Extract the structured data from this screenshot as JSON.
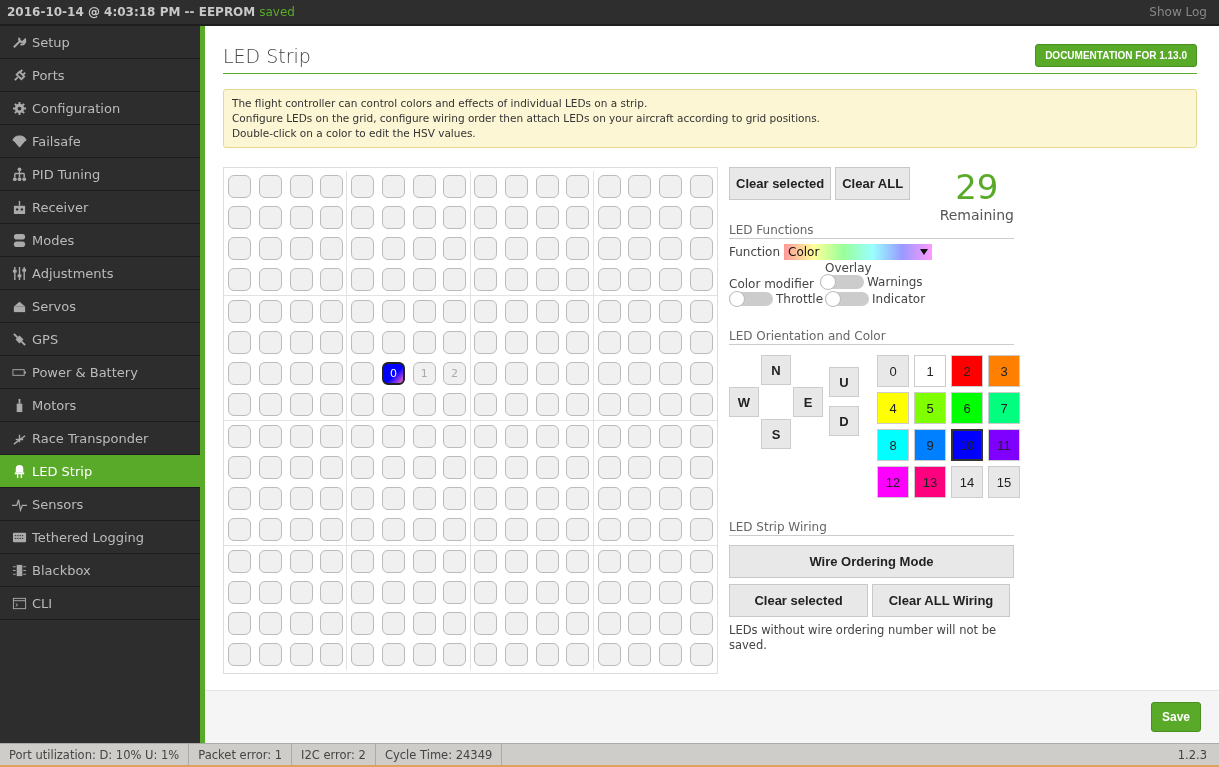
{
  "top_bar": {
    "timestamp": "2016-10-14 @ 4:03:18 PM -- EEPROM",
    "eeprom_state": "saved",
    "show_log": "Show Log"
  },
  "sidebar": {
    "items": [
      {
        "label": "Setup",
        "selected": false
      },
      {
        "label": "Ports",
        "selected": false
      },
      {
        "label": "Configuration",
        "selected": false
      },
      {
        "label": "Failsafe",
        "selected": false
      },
      {
        "label": "PID Tuning",
        "selected": false
      },
      {
        "label": "Receiver",
        "selected": false
      },
      {
        "label": "Modes",
        "selected": false
      },
      {
        "label": "Adjustments",
        "selected": false
      },
      {
        "label": "Servos",
        "selected": false
      },
      {
        "label": "GPS",
        "selected": false
      },
      {
        "label": "Power & Battery",
        "selected": false
      },
      {
        "label": "Motors",
        "selected": false
      },
      {
        "label": "Race Transponder",
        "selected": false
      },
      {
        "label": "LED Strip",
        "selected": true
      },
      {
        "label": "Sensors",
        "selected": false
      },
      {
        "label": "Tethered Logging",
        "selected": false
      },
      {
        "label": "Blackbox",
        "selected": false
      },
      {
        "label": "CLI",
        "selected": false
      }
    ]
  },
  "page": {
    "title": "LED Strip",
    "documentation_button": "DOCUMENTATION FOR 1.13.0",
    "info": [
      "The flight controller can control colors and effects of individual LEDs on a strip.",
      "Configure LEDs on the grid, configure wiring order then attach LEDs on your aircraft according to grid positions.",
      "Double-click on a color to edit the HSV values."
    ]
  },
  "led_grid": {
    "rows": [
      [
        {},
        {},
        {},
        {},
        {},
        {},
        {},
        {},
        {},
        {},
        {},
        {},
        {},
        {},
        {},
        {}
      ],
      [
        {},
        {},
        {},
        {},
        {},
        {},
        {},
        {},
        {},
        {},
        {},
        {},
        {},
        {},
        {},
        {}
      ],
      [
        {},
        {},
        {},
        {},
        {},
        {},
        {},
        {},
        {},
        {},
        {},
        {},
        {},
        {},
        {},
        {}
      ],
      [
        {},
        {},
        {},
        {},
        {},
        {},
        {},
        {},
        {},
        {},
        {},
        {},
        {},
        {},
        {},
        {}
      ],
      [
        {},
        {},
        {},
        {},
        {},
        {},
        {},
        {},
        {},
        {},
        {},
        {},
        {},
        {},
        {},
        {}
      ],
      [
        {},
        {},
        {},
        {},
        {},
        {},
        {},
        {},
        {},
        {},
        {},
        {},
        {},
        {},
        {},
        {}
      ],
      [
        {},
        {},
        {},
        {},
        {},
        {
          "wire": "0",
          "color": "#0000ff",
          "selected": true
        },
        {
          "wire": "1",
          "selected": false
        },
        {
          "wire": "2",
          "selected": false
        },
        {},
        {},
        {},
        {},
        {},
        {},
        {},
        {}
      ],
      [
        {},
        {},
        {},
        {},
        {},
        {},
        {},
        {},
        {},
        {},
        {},
        {},
        {},
        {},
        {},
        {}
      ],
      [
        {},
        {},
        {},
        {},
        {},
        {},
        {},
        {},
        {},
        {},
        {},
        {},
        {},
        {},
        {},
        {}
      ],
      [
        {},
        {},
        {},
        {},
        {},
        {},
        {},
        {},
        {},
        {},
        {},
        {},
        {},
        {},
        {},
        {}
      ],
      [
        {},
        {},
        {},
        {},
        {},
        {},
        {},
        {},
        {},
        {},
        {},
        {},
        {},
        {},
        {},
        {}
      ],
      [
        {},
        {},
        {},
        {},
        {},
        {},
        {},
        {},
        {},
        {},
        {},
        {},
        {},
        {},
        {},
        {}
      ],
      [
        {},
        {},
        {},
        {},
        {},
        {},
        {},
        {},
        {},
        {},
        {},
        {},
        {},
        {},
        {},
        {}
      ],
      [
        {},
        {},
        {},
        {},
        {},
        {},
        {},
        {},
        {},
        {},
        {},
        {},
        {},
        {},
        {},
        {}
      ],
      [
        {},
        {},
        {},
        {},
        {},
        {},
        {},
        {},
        {},
        {},
        {},
        {},
        {},
        {},
        {},
        {}
      ],
      [
        {},
        {},
        {},
        {},
        {},
        {},
        {},
        {},
        {},
        {},
        {},
        {},
        {},
        {},
        {},
        {}
      ]
    ]
  },
  "controls": {
    "clear_selected": "Clear selected",
    "clear_all": "Clear ALL",
    "remaining_count": "29",
    "remaining_label": "Remaining",
    "functions_heading": "LED Functions",
    "function_label": "Function",
    "function_value": "Color",
    "overlay_label": "Overlay",
    "color_modifier_label": "Color modifier",
    "toggles": [
      {
        "label": "Warnings",
        "on": false
      },
      {
        "label": "Throttle",
        "on": false
      },
      {
        "label": "Indicator",
        "on": false
      }
    ],
    "orientation_heading": "LED Orientation and Color",
    "directions": [
      {
        "label": "N",
        "selected": false
      },
      {
        "label": "W",
        "selected": false
      },
      {
        "label": "E",
        "selected": false
      },
      {
        "label": "S",
        "selected": false
      },
      {
        "label": "U",
        "selected": false
      },
      {
        "label": "D",
        "selected": false
      }
    ],
    "colors": [
      {
        "label": "0",
        "color": "#e8e8e8",
        "selected": false
      },
      {
        "label": "1",
        "color": "#ffffff",
        "selected": false
      },
      {
        "label": "2",
        "color": "#ff0000",
        "selected": false
      },
      {
        "label": "3",
        "color": "#ff7f00",
        "selected": false
      },
      {
        "label": "4",
        "color": "#ffff00",
        "selected": false
      },
      {
        "label": "5",
        "color": "#7fff00",
        "selected": false
      },
      {
        "label": "6",
        "color": "#00ff00",
        "selected": false
      },
      {
        "label": "7",
        "color": "#00ff7f",
        "selected": false
      },
      {
        "label": "8",
        "color": "#00ffff",
        "selected": false
      },
      {
        "label": "9",
        "color": "#007fff",
        "selected": false
      },
      {
        "label": "10",
        "color": "#0000ff",
        "selected": true
      },
      {
        "label": "11",
        "color": "#7f00ff",
        "selected": false
      },
      {
        "label": "12",
        "color": "#ff00ff",
        "selected": false
      },
      {
        "label": "13",
        "color": "#ff007f",
        "selected": false
      },
      {
        "label": "14",
        "color": "#e8e8e8",
        "selected": false
      },
      {
        "label": "15",
        "color": "#e8e8e8",
        "selected": false
      }
    ],
    "wiring_heading": "LED Strip Wiring",
    "wire_ordering": "Wire Ordering Mode",
    "wiring_clear_selected": "Clear selected",
    "wiring_clear_all": "Clear ALL Wiring",
    "wiring_note": "LEDs without wire ordering number will not be saved."
  },
  "save_button": "Save",
  "status_bar": {
    "items": [
      "Port utilization: D: 10% U: 1%",
      "Packet error: 1",
      "I2C error: 2",
      "Cycle Time: 24349"
    ],
    "version": "1.2.3"
  }
}
